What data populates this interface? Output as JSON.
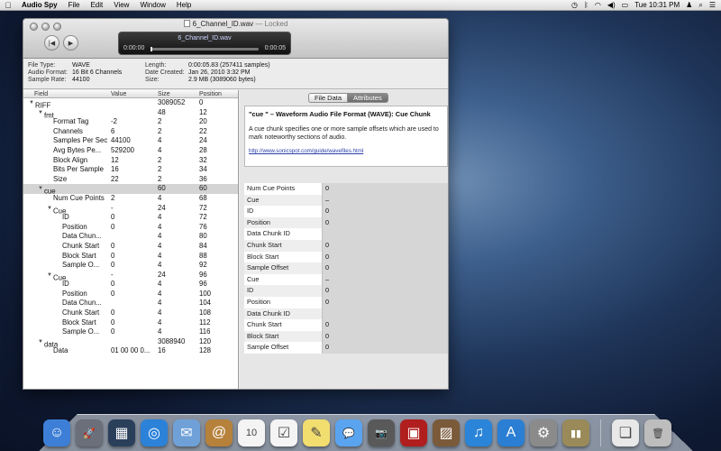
{
  "menubar": {
    "app_name": "Audio Spy",
    "items": [
      "File",
      "Edit",
      "View",
      "Window",
      "Help"
    ],
    "clock": "Tue 10:31 PM"
  },
  "window": {
    "title": "6_Channel_ID.wav",
    "title_suffix": "— Locked",
    "lcd_filename": "6_Channel_ID.wav",
    "time_start": "0:00:00",
    "time_end": "0:00:05",
    "playhead_fraction": 0.0
  },
  "info": {
    "file_type_label": "File Type:",
    "file_type": "WAVE",
    "audio_format_label": "Audio Format:",
    "audio_format": "16 Bit 6 Channels",
    "sample_rate_label": "Sample Rate:",
    "sample_rate": "44100",
    "length_label": "Length:",
    "length": "0:00:05.83 (257411 samples)",
    "date_created_label": "Date Created:",
    "date_created": "Jan 26, 2010 3:32 PM",
    "size_label": "Size:",
    "size": "2.9 MB (3089060 bytes)"
  },
  "tree": {
    "columns": [
      "Field",
      "Value",
      "Size",
      "Position"
    ],
    "rows": [
      {
        "field": "RIFF",
        "value": "",
        "size": "3089052",
        "pos": "0",
        "level": 0,
        "tri": "▼"
      },
      {
        "field": "fmt",
        "value": "",
        "size": "48",
        "pos": "12",
        "level": 1,
        "tri": "▼"
      },
      {
        "field": "Format Tag",
        "value": "-2",
        "size": "2",
        "pos": "20",
        "level": 2,
        "tri": ""
      },
      {
        "field": "Channels",
        "value": "6",
        "size": "2",
        "pos": "22",
        "level": 2,
        "tri": ""
      },
      {
        "field": "Samples Per Sec",
        "value": "44100",
        "size": "4",
        "pos": "24",
        "level": 2,
        "tri": ""
      },
      {
        "field": "Avg Bytes Pe...",
        "value": "529200",
        "size": "4",
        "pos": "28",
        "level": 2,
        "tri": ""
      },
      {
        "field": "Block Align",
        "value": "12",
        "size": "2",
        "pos": "32",
        "level": 2,
        "tri": ""
      },
      {
        "field": "Bits Per Sample",
        "value": "16",
        "size": "2",
        "pos": "34",
        "level": 2,
        "tri": ""
      },
      {
        "field": "Size",
        "value": "22",
        "size": "2",
        "pos": "36",
        "level": 2,
        "tri": ""
      },
      {
        "field": "cue",
        "value": "",
        "size": "60",
        "pos": "60",
        "level": 1,
        "tri": "▼",
        "selected": true
      },
      {
        "field": "Num Cue Points",
        "value": "2",
        "size": "4",
        "pos": "68",
        "level": 2,
        "tri": ""
      },
      {
        "field": "Cue",
        "value": "-",
        "size": "24",
        "pos": "72",
        "level": 2,
        "tri": "▼"
      },
      {
        "field": "ID",
        "value": "0",
        "size": "4",
        "pos": "72",
        "level": 3,
        "tri": ""
      },
      {
        "field": "Position",
        "value": "0",
        "size": "4",
        "pos": "76",
        "level": 3,
        "tri": ""
      },
      {
        "field": "Data Chun...",
        "value": "",
        "size": "4",
        "pos": "80",
        "level": 3,
        "tri": ""
      },
      {
        "field": "Chunk Start",
        "value": "0",
        "size": "4",
        "pos": "84",
        "level": 3,
        "tri": ""
      },
      {
        "field": "Block Start",
        "value": "0",
        "size": "4",
        "pos": "88",
        "level": 3,
        "tri": ""
      },
      {
        "field": "Sample O...",
        "value": "0",
        "size": "4",
        "pos": "92",
        "level": 3,
        "tri": ""
      },
      {
        "field": "Cue",
        "value": "-",
        "size": "24",
        "pos": "96",
        "level": 2,
        "tri": "▼"
      },
      {
        "field": "ID",
        "value": "0",
        "size": "4",
        "pos": "96",
        "level": 3,
        "tri": ""
      },
      {
        "field": "Position",
        "value": "0",
        "size": "4",
        "pos": "100",
        "level": 3,
        "tri": ""
      },
      {
        "field": "Data Chun...",
        "value": "",
        "size": "4",
        "pos": "104",
        "level": 3,
        "tri": ""
      },
      {
        "field": "Chunk Start",
        "value": "0",
        "size": "4",
        "pos": "108",
        "level": 3,
        "tri": ""
      },
      {
        "field": "Block Start",
        "value": "0",
        "size": "4",
        "pos": "112",
        "level": 3,
        "tri": ""
      },
      {
        "field": "Sample O...",
        "value": "0",
        "size": "4",
        "pos": "116",
        "level": 3,
        "tri": ""
      },
      {
        "field": "data",
        "value": "",
        "size": "3088940",
        "pos": "120",
        "level": 1,
        "tri": "▼"
      },
      {
        "field": "Data",
        "value": "01 00 00 0...",
        "size": "16",
        "pos": "128",
        "level": 2,
        "tri": ""
      }
    ]
  },
  "detail": {
    "tabs": [
      "File Data",
      "Attributes"
    ],
    "active_tab": "Attributes",
    "title": "\"cue \" – Waveform Audio File Format (WAVE): Cue Chunk",
    "body": "A cue chunk specifies one or more sample offsets which are used to mark noteworthy sections of audio.",
    "link": "http://www.sonicspot.com/guide/wavefiles.html",
    "attributes": [
      {
        "k": "Num Cue Points",
        "v": "0"
      },
      {
        "k": "Cue",
        "v": "–"
      },
      {
        "k": "ID",
        "v": "0"
      },
      {
        "k": "Position",
        "v": "0"
      },
      {
        "k": "Data Chunk ID",
        "v": ""
      },
      {
        "k": "Chunk Start",
        "v": "0"
      },
      {
        "k": "Block Start",
        "v": "0"
      },
      {
        "k": "Sample Offset",
        "v": "0"
      },
      {
        "k": "Cue",
        "v": "–"
      },
      {
        "k": "ID",
        "v": "0"
      },
      {
        "k": "Position",
        "v": "0"
      },
      {
        "k": "Data Chunk ID",
        "v": ""
      },
      {
        "k": "Chunk Start",
        "v": "0"
      },
      {
        "k": "Block Start",
        "v": "0"
      },
      {
        "k": "Sample Offset",
        "v": "0"
      }
    ]
  },
  "dock": {
    "icons": [
      {
        "name": "finder-icon",
        "glyph": "☺",
        "color": "#3d7fd6"
      },
      {
        "name": "launchpad-icon",
        "glyph": "🚀",
        "color": "#6a6f7a"
      },
      {
        "name": "mission-control-icon",
        "glyph": "▦",
        "color": "#2a3f5a"
      },
      {
        "name": "safari-icon",
        "glyph": "◎",
        "color": "#2c82d9"
      },
      {
        "name": "mail-icon",
        "glyph": "✉",
        "color": "#6fa1d8"
      },
      {
        "name": "contacts-icon",
        "glyph": "@",
        "color": "#b5813b"
      },
      {
        "name": "calendar-icon",
        "glyph": "10",
        "color": "#f4f4f4"
      },
      {
        "name": "reminders-icon",
        "glyph": "☑",
        "color": "#f4f4f4"
      },
      {
        "name": "notes-icon",
        "glyph": "✎",
        "color": "#f2dd6f"
      },
      {
        "name": "messages-icon",
        "glyph": "💬",
        "color": "#5aa4ef"
      },
      {
        "name": "facetime-icon",
        "glyph": "📷",
        "color": "#595959"
      },
      {
        "name": "photo-booth-icon",
        "glyph": "▣",
        "color": "#b01e1e"
      },
      {
        "name": "iphoto-icon",
        "glyph": "▨",
        "color": "#7b5a3a"
      },
      {
        "name": "itunes-icon",
        "glyph": "♫",
        "color": "#2a84d8"
      },
      {
        "name": "app-store-icon",
        "glyph": "A",
        "color": "#2a7fd4"
      },
      {
        "name": "system-preferences-icon",
        "glyph": "⚙",
        "color": "#8b8b8b"
      },
      {
        "name": "audio-spy-icon",
        "glyph": "▮▮",
        "color": "#9a8a5a"
      },
      {
        "name": "documents-stack-icon",
        "glyph": "❏",
        "color": "#e8e8e8"
      },
      {
        "name": "trash-icon",
        "glyph": "🗑",
        "color": "#bdbdbd"
      }
    ]
  }
}
